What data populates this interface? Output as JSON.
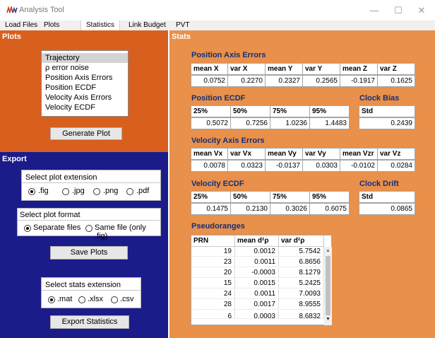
{
  "window": {
    "title": "Analysis Tool",
    "icon": "waveform-icon",
    "controls": [
      "minimize-icon",
      "maximize-icon",
      "close-icon"
    ]
  },
  "tabs": [
    {
      "label": "Load Files",
      "active": false
    },
    {
      "label": "Plots",
      "active": false
    },
    {
      "label": "Statistics",
      "active": true
    },
    {
      "label": "Link Budget",
      "active": false
    },
    {
      "label": "PVT",
      "active": false
    }
  ],
  "plots": {
    "title": "Plots",
    "items": [
      "Trajectory",
      "ρ error noise",
      "Position Axis Errors",
      "Position ECDF",
      "Velocity Axis Errors",
      "Velocity ECDF"
    ],
    "selected_index": 0,
    "generate_button": "Generate Plot"
  },
  "export": {
    "title": "Export",
    "extension": {
      "label": "Select plot extension",
      "options": [
        ".fig",
        ".jpg",
        ".png",
        ".pdf"
      ],
      "selected": ".fig"
    },
    "format": {
      "label": "Select plot format",
      "options": [
        "Separate files",
        "Same file (only .fig)"
      ],
      "selected": "Separate files"
    },
    "save_button": "Save Plots",
    "stats_ext": {
      "label": "Select stats extension",
      "options": [
        ".mat",
        ".xlsx",
        ".csv"
      ],
      "selected": ".mat"
    },
    "export_button": "Export Statistics"
  },
  "stats": {
    "title": "Stats",
    "position_axis": {
      "title": "Position Axis Errors",
      "headers": [
        "mean X",
        "var X",
        "mean Y",
        "var Y",
        "mean Z",
        "var Z"
      ],
      "values": [
        "0.0752",
        "0.2270",
        "0.2327",
        "0.2565",
        "-0.1917",
        "0.1625"
      ]
    },
    "position_ecdf": {
      "title": "Position ECDF",
      "headers": [
        "25%",
        "50%",
        "75%",
        "95%"
      ],
      "values": [
        "0.5072",
        "0.7256",
        "1.0236",
        "1.4483"
      ]
    },
    "clock_bias": {
      "title": "Clock Bias",
      "header": "Std",
      "value": "0.2439"
    },
    "velocity_axis": {
      "title": "Velocity Axis Errors",
      "headers": [
        "mean Vx",
        "var Vx",
        "mean Vy",
        "var Vy",
        "mean Vzr",
        "var Vz"
      ],
      "values": [
        "0.0078",
        "0.0323",
        "-0.0137",
        "0.0303",
        "-0.0102",
        "0.0284"
      ]
    },
    "velocity_ecdf": {
      "title": "Velocity ECDF",
      "headers": [
        "25%",
        "50%",
        "75%",
        "95%"
      ],
      "values": [
        "0.1475",
        "0.2130",
        "0.3026",
        "0.6075"
      ]
    },
    "clock_drift": {
      "title": "Clock Drift",
      "header": "Std",
      "value": "0.0865"
    },
    "pseudoranges": {
      "title": "Pseudoranges",
      "headers": [
        "PRN",
        "mean d²ρ",
        "var d²ρ"
      ],
      "rows": [
        [
          "19",
          "0.0012",
          "5.7542"
        ],
        [
          "23",
          "0.0011",
          "6.8656"
        ],
        [
          "20",
          "-0.0003",
          "8.1279"
        ],
        [
          "15",
          "0.0015",
          "5.2425"
        ],
        [
          "24",
          "0.0011",
          "7.0093"
        ],
        [
          "28",
          "0.0017",
          "8.9555"
        ],
        [
          "6",
          "0.0003",
          "8.6832"
        ]
      ]
    }
  },
  "colors": {
    "plots_panel": "#d95f1e",
    "export_panel": "#1b1b8a",
    "stats_panel": "#e9904a",
    "section_title": "#122f7a"
  }
}
